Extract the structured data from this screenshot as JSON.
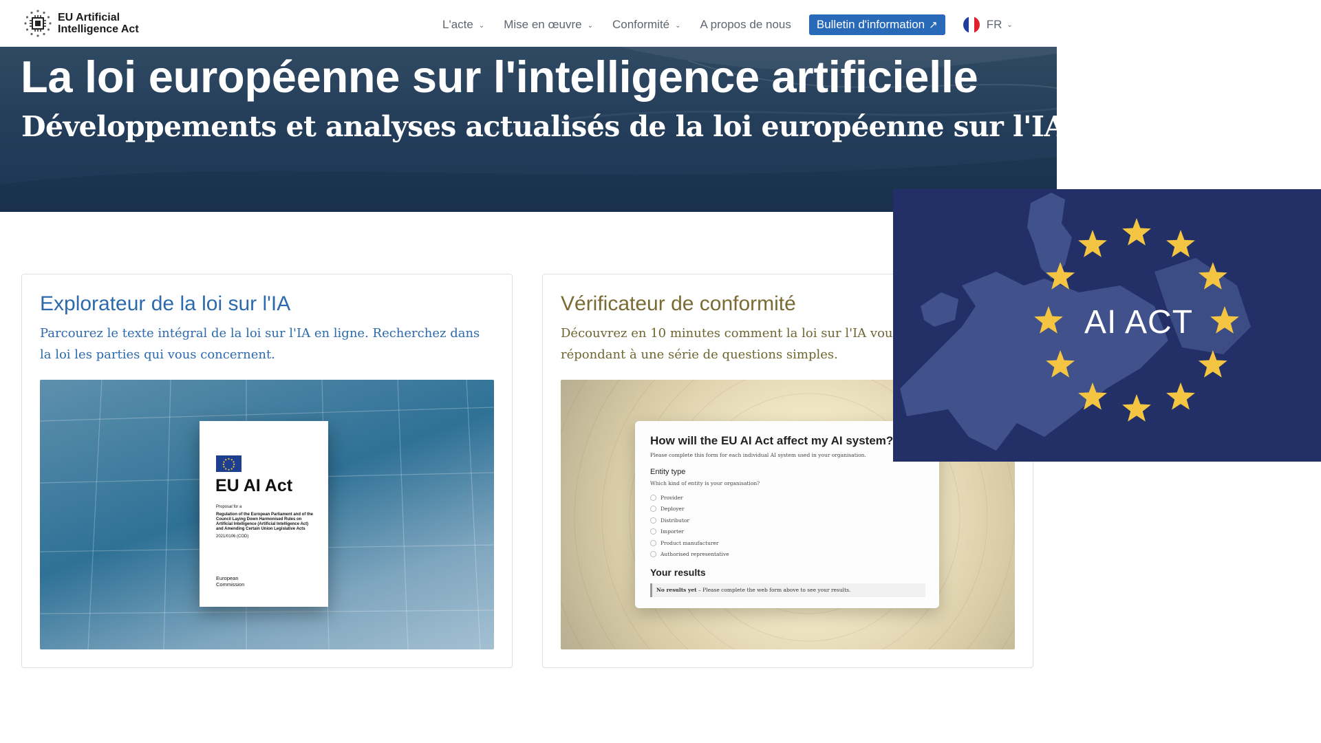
{
  "header": {
    "logo_line1": "EU Artificial",
    "logo_line2": "Intelligence Act",
    "nav": [
      {
        "label": "L'acte",
        "dropdown": true
      },
      {
        "label": "Mise en œuvre",
        "dropdown": true
      },
      {
        "label": "Conformité",
        "dropdown": true
      },
      {
        "label": "A propos de nous",
        "dropdown": false
      }
    ],
    "newsletter_label": "Bulletin d'information",
    "newsletter_icon": "external-arrow-icon",
    "language": "FR",
    "language_flag": "france-flag-icon"
  },
  "hero": {
    "title": "La loi européenne sur l'intelligence artificielle",
    "subtitle": "Développements et analyses actualisés de la loi européenne sur l'IA"
  },
  "cards": [
    {
      "title": "Explorateur de la loi sur l'IA",
      "description": "Parcourez le texte intégral de la loi sur l'IA en ligne. Recherchez dans la loi les parties qui vous concernent.",
      "image": {
        "doc_title": "EU AI Act",
        "doc_proposal": "Proposal for a",
        "doc_body": "Regulation of the European Parliament and of the Council Laying Down Harmonised Rules on Artificial Intelligence (Artificial Intelligence Act) and Amending Certain Union Legislative Acts",
        "doc_number": "2021/0106 (COD)",
        "doc_footer_1": "European",
        "doc_footer_2": "Commission"
      }
    },
    {
      "title": "Vérificateur de conformité",
      "description": "Découvrez en 10 minutes comment la loi sur l'IA vous affecte en répondant à une série de questions simples.",
      "image": {
        "form_title": "How will the EU AI Act affect my AI system?",
        "form_hint": "Please complete this form for each individual AI system used in your organisation.",
        "entity_label": "Entity type",
        "entity_question": "Which kind of entity is your organisation?",
        "options": [
          "Provider",
          "Deployer",
          "Distributor",
          "Importer",
          "Product manufacturer",
          "Authorised representative"
        ],
        "results_title": "Your results",
        "results_bold": "No results yet",
        "results_text": " – Please complete the web form above to see your results."
      }
    }
  ],
  "overlay": {
    "text": "AI ACT",
    "background_color": "#233067",
    "star_color": "#f4c542",
    "star_count": 12
  },
  "colors": {
    "accent_blue": "#2869b8",
    "card1_text": "#2c6aad",
    "card2_text": "#7a6a33",
    "hero_bg": "#253f5b"
  }
}
